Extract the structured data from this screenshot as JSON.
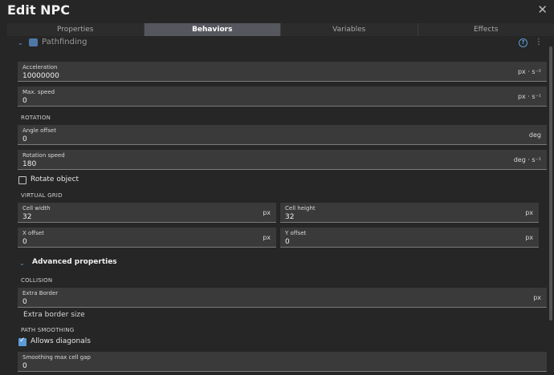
{
  "window": {
    "title": "Edit NPC",
    "close_icon": "close-icon"
  },
  "tabs": [
    {
      "label": "Properties"
    },
    {
      "label": "Behaviors",
      "active": true
    },
    {
      "label": "Variables"
    },
    {
      "label": "Effects"
    }
  ],
  "behavior": {
    "name": "Pathfinding",
    "help_icon": "?",
    "menu_icon": "⋮"
  },
  "fields": {
    "acceleration": {
      "label": "Acceleration",
      "value": "10000000",
      "unit": "px · s⁻²"
    },
    "max_speed": {
      "label": "Max. speed",
      "value": "0",
      "unit": "px · s⁻¹"
    },
    "angle_offset": {
      "label": "Angle offset",
      "value": "0",
      "unit": "deg"
    },
    "rotation_speed": {
      "label": "Rotation speed",
      "value": "180",
      "unit": "deg · s⁻¹"
    },
    "cell_width": {
      "label": "Cell width",
      "value": "32",
      "unit": "px"
    },
    "cell_height": {
      "label": "Cell height",
      "value": "32",
      "unit": "px"
    },
    "x_offset": {
      "label": "X offset",
      "value": "0",
      "unit": "px"
    },
    "y_offset": {
      "label": "Y offset",
      "value": "0",
      "unit": "px"
    },
    "extra_border": {
      "label": "Extra Border",
      "value": "0",
      "unit": "px"
    },
    "smoothing_gap": {
      "label": "Smoothing max cell gap",
      "value": "0"
    }
  },
  "sections": {
    "rotation": "ROTATION",
    "virtual_grid": "VIRTUAL GRID",
    "advanced": "Advanced properties",
    "collision": "COLLISION",
    "path_smoothing": "PATH SMOOTHING"
  },
  "checkboxes": {
    "rotate_object": {
      "label": "Rotate object",
      "checked": false
    },
    "allows_diagonals": {
      "label": "Allows diagonals",
      "checked": true
    }
  },
  "helper_text": {
    "extra_border": "Extra border size"
  },
  "colors": {
    "accent": "#5b9bd5",
    "background": "#262626",
    "field": "#3a3a3a",
    "active_tab": "#56565e"
  }
}
